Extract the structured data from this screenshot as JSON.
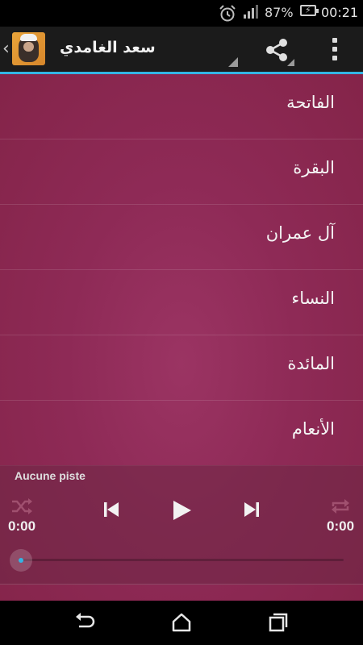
{
  "status_bar": {
    "battery_percent": "87%",
    "time": "00:21",
    "icons": [
      "alarm-icon",
      "signal-icon",
      "battery-charging-icon"
    ]
  },
  "action_bar": {
    "title": "سعد الغامدي",
    "icons": [
      "up-chevron-icon",
      "app-avatar",
      "share-icon",
      "overflow-menu-icon"
    ]
  },
  "surahs": [
    {
      "name": "الفاتحة"
    },
    {
      "name": "البقرة"
    },
    {
      "name": "آل عمران"
    },
    {
      "name": "النساء"
    },
    {
      "name": "المائدة"
    },
    {
      "name": "الأنعام"
    }
  ],
  "player": {
    "track_name": "Aucune piste",
    "elapsed": "0:00",
    "duration": "0:00",
    "progress": 0,
    "icons": [
      "shuffle-icon",
      "previous-icon",
      "play-icon",
      "next-icon",
      "repeat-icon"
    ]
  },
  "nav_bar": {
    "icons": [
      "back-icon",
      "home-icon",
      "recents-icon"
    ]
  },
  "colors": {
    "accent": "#33b5e5",
    "list_background": "#8e2a56",
    "action_bar": "#1b1b1b"
  }
}
